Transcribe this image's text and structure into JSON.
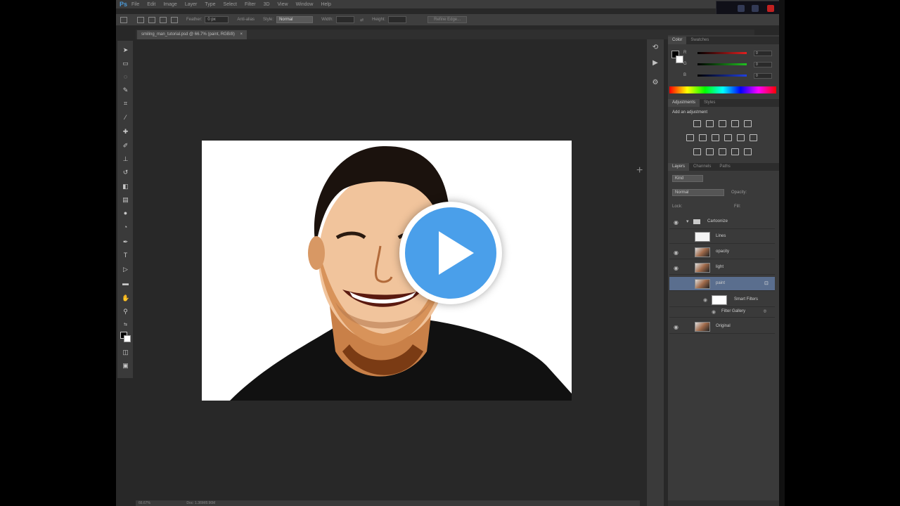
{
  "app": {
    "logo": "Ps",
    "menu": [
      "File",
      "Edit",
      "Image",
      "Layer",
      "Type",
      "Select",
      "Filter",
      "3D",
      "View",
      "Window",
      "Help"
    ]
  },
  "options": {
    "feather_label": "Feather:",
    "feather_value": "0 px",
    "antialias_label": "Anti-alias",
    "style_label": "Style:",
    "style_value": "Normal",
    "width_label": "Width:",
    "height_label": "Height:",
    "refine_edge_label": "Refine Edge..."
  },
  "document": {
    "tab_title": "smiling_man_tutorial.psd @ 66.7% (paint, RGB/8)"
  },
  "color_panel": {
    "tabs": [
      "Color",
      "Swatches"
    ],
    "channels": [
      {
        "label": "R",
        "value": "0",
        "color": "#d03030"
      },
      {
        "label": "G",
        "value": "0",
        "color": "#30b030"
      },
      {
        "label": "B",
        "value": "0",
        "color": "#3050d0"
      }
    ]
  },
  "adjustments_panel": {
    "tabs": [
      "Adjustments",
      "Styles"
    ],
    "heading": "Add an adjustment"
  },
  "layers_panel": {
    "tabs": [
      "Layers",
      "Channels",
      "Paths"
    ],
    "kind_filter": "Kind",
    "blend_mode": "Normal",
    "opacity_label": "Opacity:",
    "lock_label": "Lock:",
    "fill_label": "Fill:",
    "layers": [
      {
        "name": "Cartoonize",
        "type": "group"
      },
      {
        "name": "Lines",
        "type": "plain"
      },
      {
        "name": "opacity",
        "type": "photo"
      },
      {
        "name": "light",
        "type": "photo"
      },
      {
        "name": "paint",
        "type": "photo",
        "selected": true
      },
      {
        "name": "Smart Filters",
        "type": "filter"
      },
      {
        "name": "Filter Gallery",
        "type": "filter-item"
      },
      {
        "name": "Original",
        "type": "photo"
      }
    ]
  },
  "status": {
    "zoom": "66.67%",
    "doc_size": "Doc: 1.36M/8.96M"
  },
  "video": {
    "play_color": "#4a9fea"
  }
}
